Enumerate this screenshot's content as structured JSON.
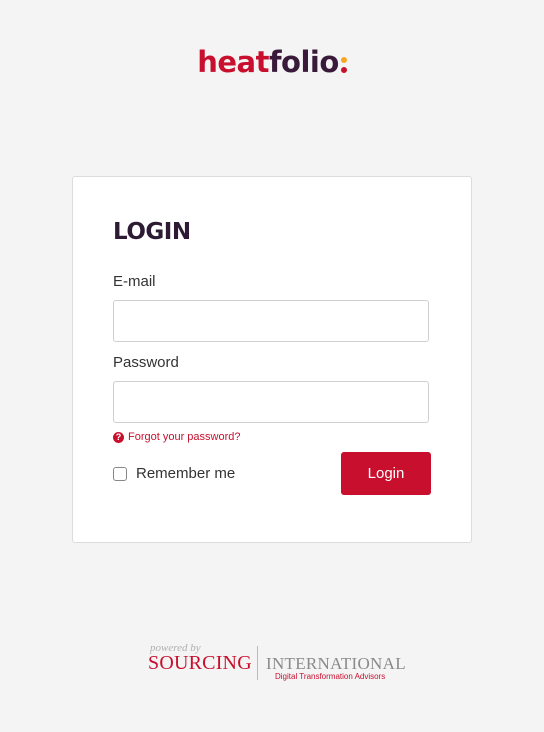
{
  "brand": {
    "logo_part1": "heat",
    "logo_part2": "folio",
    "dot_colors": [
      "#f5a623",
      "#7cb342",
      "#c8102e"
    ]
  },
  "login": {
    "title": "LOGIN",
    "email_label": "E-mail",
    "email_value": "",
    "email_placeholder": "",
    "password_label": "Password",
    "password_value": "",
    "password_placeholder": "",
    "forgot_text": "Forgot your password?",
    "help_icon": "question-circle-icon",
    "remember_label": "Remember me",
    "remember_checked": false,
    "submit_label": "Login"
  },
  "footer": {
    "powered_by": "powered by",
    "sourcing": "SOURCING",
    "international": "INTERNATIONAL",
    "tagline": "Digital Transformation Advisors"
  },
  "colors": {
    "accent": "#c8102e",
    "background": "#f4f4f4",
    "title": "#2d1a33"
  }
}
